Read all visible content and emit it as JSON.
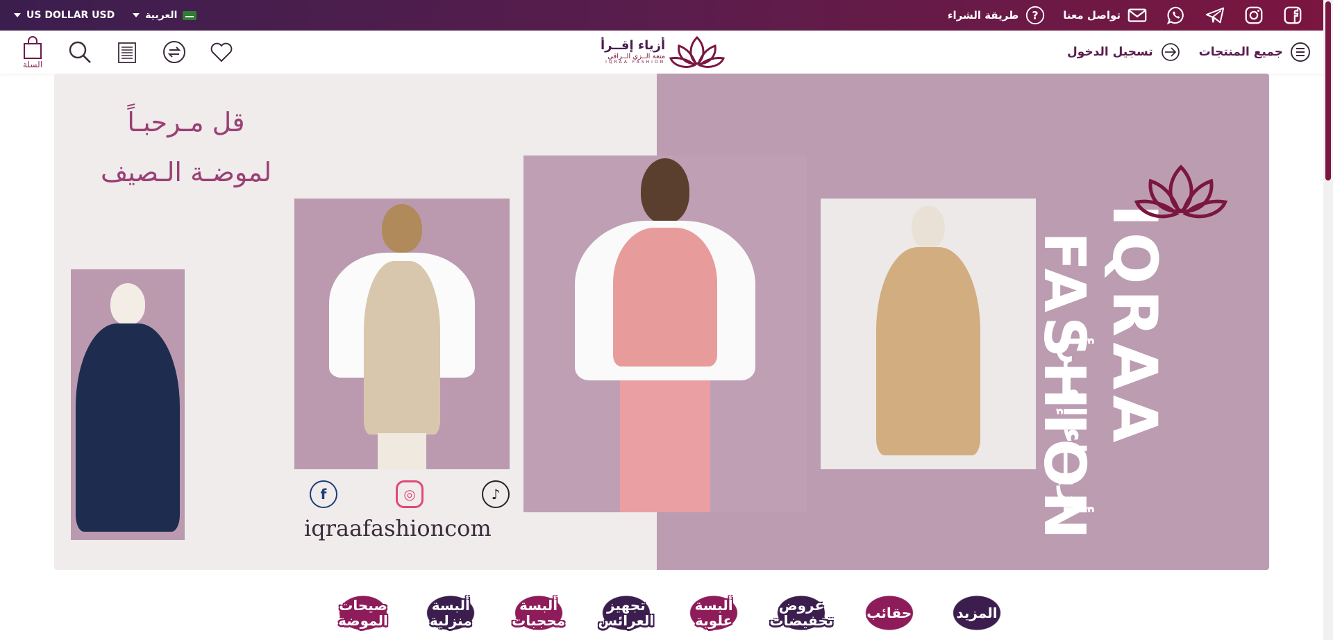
{
  "topbar": {
    "currency": "US DOLLAR USD",
    "language": "العربية",
    "how_to_buy": "طريقة الشراء",
    "contact": "تواصل معنا",
    "social_icons": [
      "whatsapp-icon",
      "telegram-icon",
      "instagram-icon",
      "facebook-icon"
    ]
  },
  "header": {
    "cart_label": "السلة",
    "logo_ar": "أزياء إقــرأ",
    "logo_sub": "متعة الــزي الــراقي",
    "logo_en": "IQRAA FASHION",
    "login": "تسجيل الدخول",
    "all_products": "جميع المنتجات"
  },
  "banner": {
    "headline_1": "قل مـرحبـاً",
    "headline_2": "لموضـة الـصيف",
    "website": "iqraafashioncom",
    "brand_en_1": "IQRAA",
    "brand_en_2": "FASHION",
    "brand_ar": "أزيــاء إقــرأ"
  },
  "categories": [
    {
      "label": "صيحات الموضة",
      "color": "#8e1c5a"
    },
    {
      "label": "ألبسة منزلية",
      "color": "#3b1e4e"
    },
    {
      "label": "ألبسة محجبات",
      "color": "#8e1c5a"
    },
    {
      "label": "تجهيز العرائس",
      "color": "#3b1e4e"
    },
    {
      "label": "ألبسة علوية",
      "color": "#8e1c5a"
    },
    {
      "label": "عروض تخفيضات",
      "color": "#3b1e4e"
    },
    {
      "label": "حقائب",
      "color": "#8e1c5a"
    },
    {
      "label": "المزيد",
      "color": "#3b1e4e"
    }
  ],
  "colors": {
    "brand": "#7a1640",
    "purple": "#3b1e4e",
    "mauve": "#bc9cb1"
  }
}
